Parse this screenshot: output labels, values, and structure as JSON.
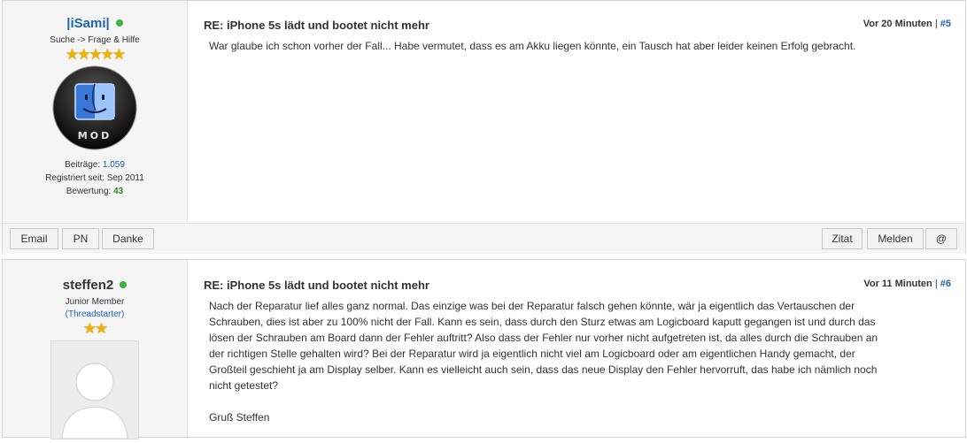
{
  "posts": [
    {
      "author": {
        "name": "|iSami|",
        "rank": "Suche -> Frage & Hilfe",
        "stats": [
          {
            "label": "Beiträge:",
            "value": "1.059"
          },
          {
            "label": "Registriert seit:",
            "value": "Sep 2011"
          },
          {
            "label": "Bewertung:",
            "value": "43"
          }
        ],
        "avatar_text": "MOD"
      },
      "title": "RE: iPhone 5s lädt und bootet nicht mehr",
      "time": "Vor 20 Minuten",
      "number": "#5",
      "body": "War glaube ich schon vorher der Fall... Habe vermutet, dass es am Akku liegen könnte, ein Tausch hat aber leider keinen Erfolg gebracht.",
      "buttons_left": [
        "Email",
        "PN",
        "Danke"
      ],
      "buttons_right": [
        "Zitat",
        "Melden",
        "@"
      ]
    },
    {
      "author": {
        "name": "steffen2",
        "rank": "Junior Member",
        "starter": "(Threadstarter)"
      },
      "title": "RE: iPhone 5s lädt und bootet nicht mehr",
      "time": "Vor 11 Minuten",
      "number": "#6",
      "body_lines": [
        "Nach der Reparatur lief alles ganz normal. Das einzige was bei der Reparatur falsch gehen könnte, wär ja eigentlich das Vertauschen der",
        "Schrauben, dies ist aber zu 100% nicht der Fall. Kann es sein, dass durch den Sturz etwas am Logicboard kaputt gegangen ist und durch das",
        "lösen der Schrauben am Board dann der Fehler auftritt? Also dass der Fehler nur vorher nicht aufgetreten ist, da alles durch die Schrauben an",
        "der richtigen Stelle gehalten wird? Bei der Reparatur wird ja eigentlich nicht viel am Logicboard oder am eigentlichen Handy gemacht, der",
        "Großteil geschieht ja am Display selber. Kann es vielleicht auch sein, dass das neue Display den Fehler hervorruft, das habe ich nämlich noch",
        "nicht getestet?"
      ],
      "signoff": "Gruß Steffen"
    }
  ]
}
